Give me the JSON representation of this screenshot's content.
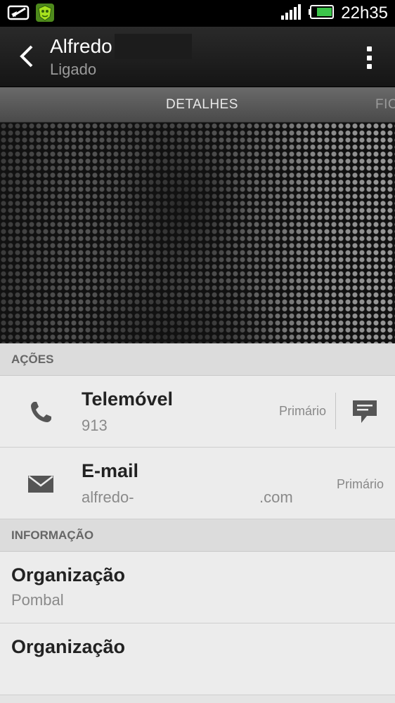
{
  "status_bar": {
    "time": "22h35",
    "icons": [
      "feed-icon",
      "shield-app-icon",
      "signal-icon",
      "battery-icon"
    ]
  },
  "action_bar": {
    "name": "Alfredo",
    "status": "Ligado",
    "back_icon": "back-arrow-icon",
    "menu_icon": "overflow-menu-icon"
  },
  "tabs": [
    {
      "label": "DETALHES",
      "selected": true
    },
    {
      "label": "FIC",
      "selected": false
    }
  ],
  "sections": {
    "actions_header": "AÇÕES",
    "info_header": "INFORMAÇÃO"
  },
  "phone": {
    "label": "Telemóvel",
    "value": "913",
    "badge": "Primário",
    "icon": "phone-icon",
    "sms_icon": "message-icon"
  },
  "email": {
    "label": "E-mail",
    "value": "alfredo-",
    "suffix": ".com",
    "badge": "Primário",
    "icon": "envelope-icon"
  },
  "info": [
    {
      "label": "Organização",
      "value": "Pombal"
    },
    {
      "label": "Organização",
      "value": ""
    }
  ],
  "colors": {
    "status_bar_bg": "#000000",
    "action_bar_bg": "#1e1e1e",
    "tab_bar_bg": "#555555",
    "list_bg": "#ececec",
    "section_header_bg": "#dcdcdc",
    "battery_green": "#3cc44a"
  }
}
